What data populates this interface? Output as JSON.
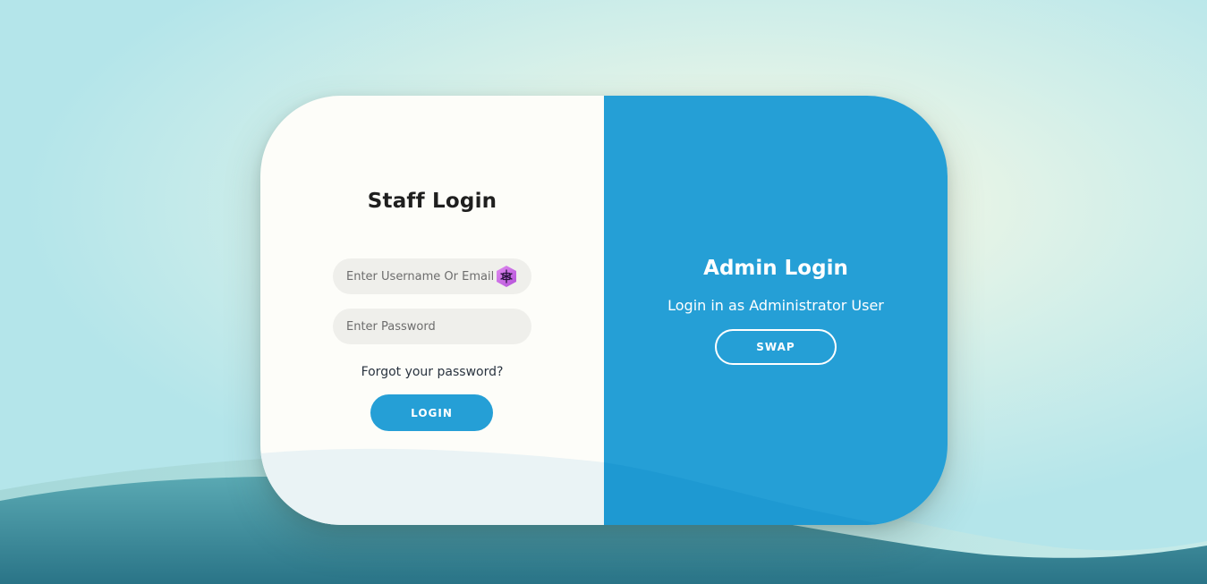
{
  "staff": {
    "title": "Staff Login",
    "username_placeholder": "Enter Username Or Email",
    "password_placeholder": "Enter Password",
    "forgot_link": "Forgot your password?",
    "login_label": "LOGIN"
  },
  "admin": {
    "title": "Admin Login",
    "subtitle": "Login in as Administrator User",
    "swap_label": "SWAP"
  },
  "extension_icon": "password-manager-icon",
  "colors": {
    "accent": "#259fd6",
    "card_left": "#fdfdf9",
    "input_bg": "#efefeb",
    "wave_dark": "#2f8193",
    "wave_light": "#9fd3d6"
  }
}
